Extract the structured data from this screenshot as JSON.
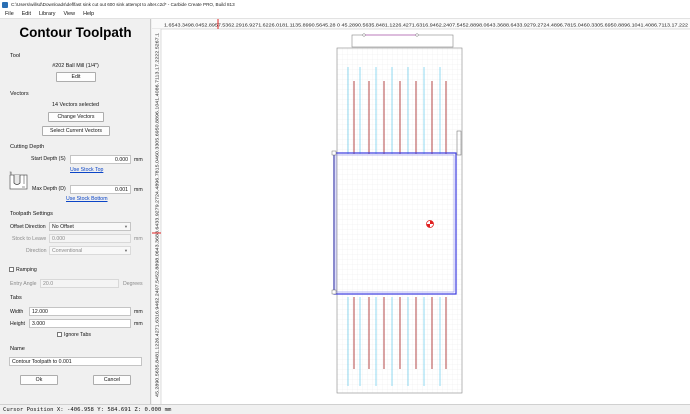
{
  "window": {
    "title": "C:\\Users\\willsd\\Downloads\\deflfast sink cut out 600 sink attempt to alter.c2d* - Carbide Create PRO, Build 813"
  },
  "menu": [
    "File",
    "Edit",
    "Library",
    "View",
    "Help"
  ],
  "panel": {
    "title": "Contour Toolpath",
    "tool": {
      "section": "Tool",
      "name": "#202 Ball Mill (1/4\")",
      "edit_label": "Edit"
    },
    "vectors": {
      "section": "Vectors",
      "selected_text": "14 Vectors selected",
      "change_label": "Change Vectors",
      "select_current_label": "Select Current Vectors"
    },
    "cutting_depth": {
      "section": "Cutting Depth",
      "start_label": "Start Depth (S)",
      "start_value": "0.000",
      "start_unit": "mm",
      "use_stock_top": "Use Stock Top",
      "max_label": "Max Depth (D)",
      "max_value": "0.001",
      "max_unit": "mm",
      "use_stock_bottom": "Use Stock Bottom"
    },
    "toolpath_settings": {
      "section": "Toolpath Settings",
      "offset_label": "Offset Direction",
      "offset_value": "No Offset",
      "stock_label": "Stock to Leave",
      "stock_value": "0.000",
      "stock_unit": "mm",
      "direction_label": "Direction",
      "direction_value": "Conventional"
    },
    "ramping": {
      "label": "Ramping",
      "checked": false,
      "entry_angle_label": "Entry Angle",
      "entry_angle_value": "20.0",
      "entry_angle_unit": "Degrees"
    },
    "tabs": {
      "section": "Tabs",
      "width_label": "Width",
      "width_value": "12.000",
      "width_unit": "mm",
      "height_label": "Height",
      "height_value": "3.000",
      "height_unit": "mm",
      "ignore_label": "Ignore Tabs",
      "ignore_checked": false
    },
    "name": {
      "section": "Name",
      "value": "Contour Toolpath to 0.001"
    },
    "ok_label": "Ok",
    "cancel_label": "Cancel"
  },
  "ruler": {
    "top_text": "1.6543.3498.0452.8957.5362.2916.9271.6226.0181.1135.8990.5645.28  0  45.2890.5635.8481.1226.4271.6316.9462.2407.5452.8898.0643.3688.6433.9279.2724.4896.7815.0460.3305.6950.8896.1041.4086.7113.17.222",
    "left_text": "45.2890.5635.8481.1226.4271.6316.9462.2407.5452.8898.0643.3688.6433.9279.2724.4896.7815.0460.3305.6950.8896.1041.4086.7113.17.2222.5267.1"
  },
  "status": {
    "cursor_text": "Cursor Position X:  -406.958  Y:  584.691  Z:  0.000 mm"
  },
  "colors": {
    "accent_blue": "#0b45c7",
    "toolpath_blue": "#3a3adf",
    "tab_cyan": "#27b6e6",
    "cut_red": "#b01818",
    "home_red": "#e02020"
  }
}
